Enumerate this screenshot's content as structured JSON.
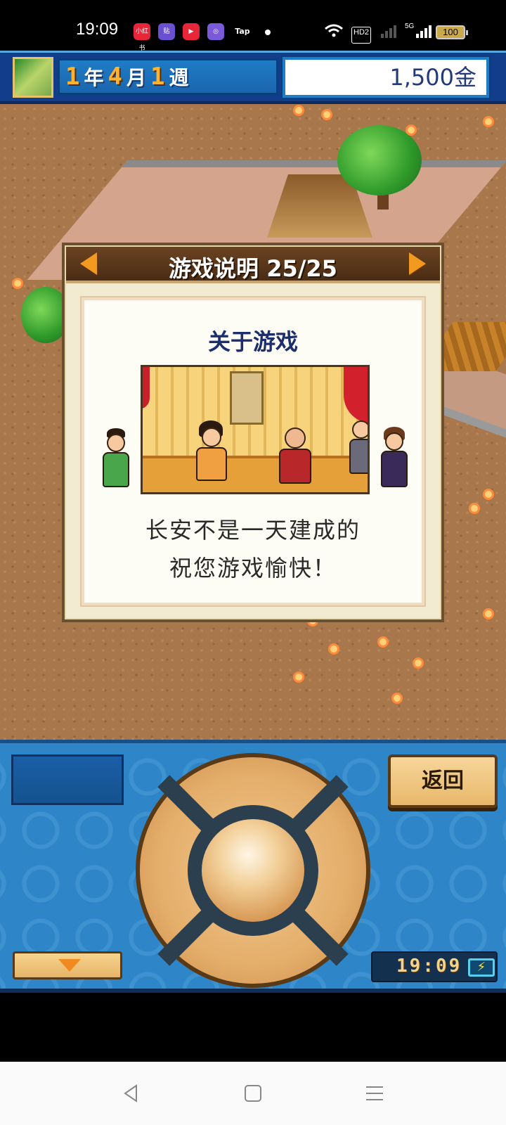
{
  "status_bar": {
    "time": "19:09",
    "app_icons": [
      "小红书",
      "贴",
      "▶",
      "◎",
      "Tap"
    ],
    "network_badge": "HD2",
    "signal_label": "5G",
    "battery": "100"
  },
  "top_bar": {
    "year_num": "1",
    "year_unit": "年",
    "month_num": "4",
    "month_unit": "月",
    "week_num": "1",
    "week_unit": "週",
    "money": "1,500金"
  },
  "dialog": {
    "title": "游戏说明 25/25",
    "section_title": "关于游戏",
    "message_line1": "长安不是一天建成的",
    "message_line2": "祝您游戏愉快！"
  },
  "controls": {
    "back_label": "返回",
    "clock": "19:09"
  },
  "colors": {
    "accent_blue": "#2e86c8",
    "gold": "#f29a1f",
    "dialog_brown": "#4a2c14"
  },
  "icons": {
    "prev": "arrow-left-icon",
    "next": "arrow-right-icon",
    "down": "arrow-down-icon",
    "charge": "charging-icon"
  }
}
